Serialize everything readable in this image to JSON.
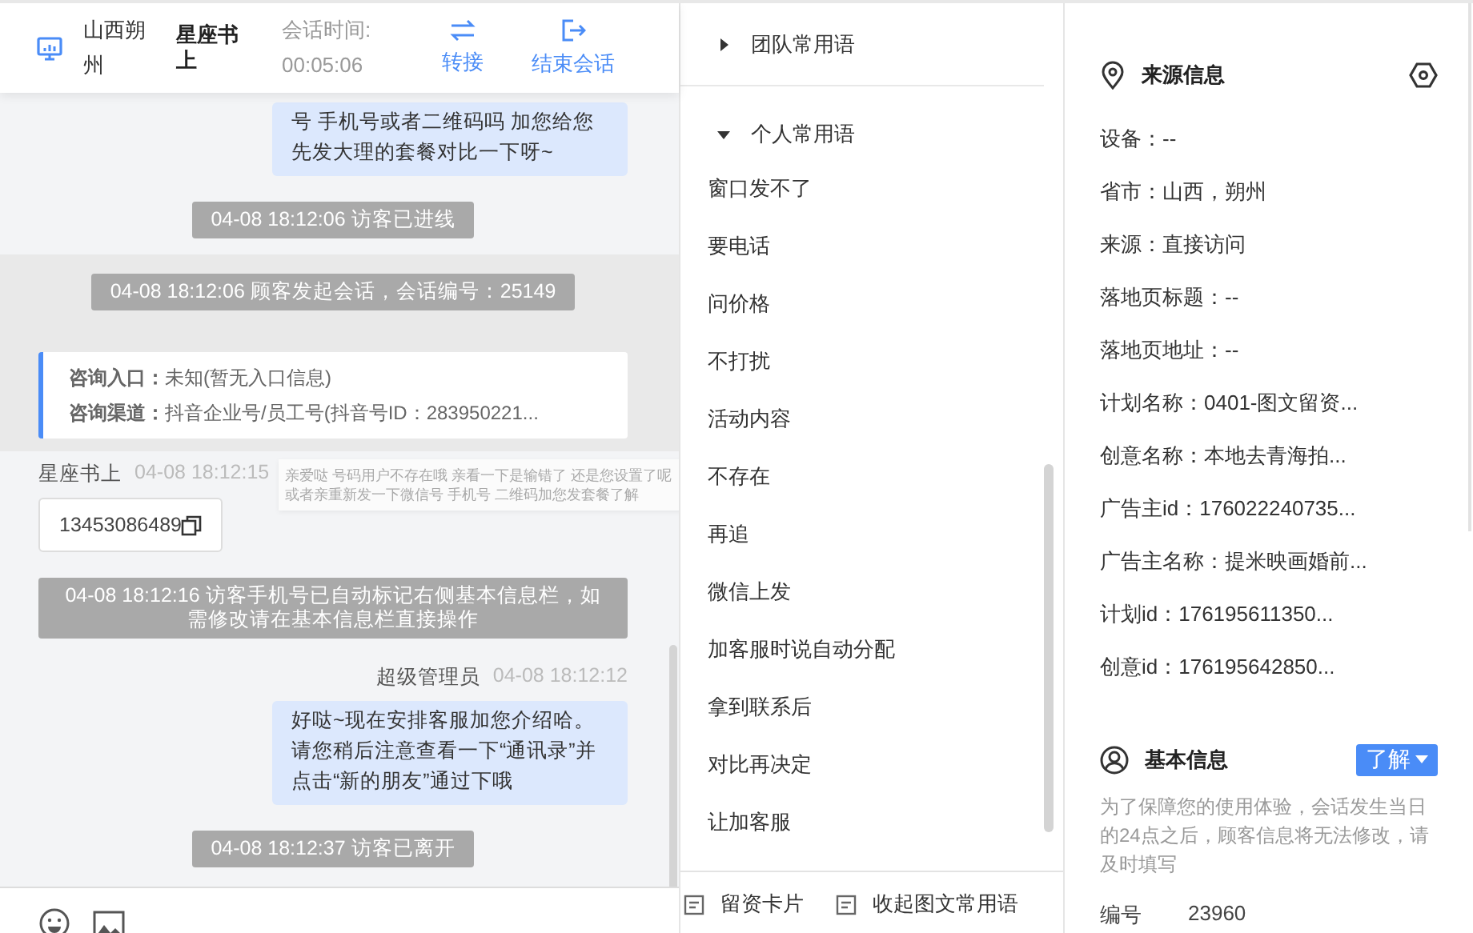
{
  "chat_header": {
    "location": "山西朔州",
    "visitor": "星座书上",
    "timer_label": "会话时间:",
    "timer": "00:05:06",
    "actions": [
      {
        "kind": "transfer",
        "label": "转接"
      },
      {
        "kind": "end",
        "label": "结束会话"
      }
    ]
  },
  "messages": [
    {
      "kind": "agent_bubble",
      "highlighted": false,
      "text": "号 手机号或者二维码吗 加您给您先发大理的套餐对比一下呀~"
    },
    {
      "kind": "system",
      "highlighted": false,
      "text": "04-08 18:12:06 访客已进线"
    },
    {
      "kind": "system",
      "highlighted": true,
      "text": "04-08 18:12:06 顾客发起会话，会话编号：25149"
    },
    {
      "kind": "info_card",
      "highlighted": true,
      "lines": [
        "**咨询入口：**未知(暂无入口信息)",
        "**咨询渠道：**抖音企业号/员工号(抖音号ID：283950221..."
      ]
    },
    {
      "kind": "visitor",
      "highlighted": false,
      "sender": "星座书上",
      "time": "04-08 18:12:15",
      "text": "13453086489"
    },
    {
      "kind": "system",
      "highlighted": false,
      "text": "04-08 18:12:16 访客手机号已自动标记右侧基本信息栏，如需修改请在基本信息栏直接操作"
    },
    {
      "kind": "agent",
      "highlighted": false,
      "sender": "超级管理员",
      "time": "04-08 18:12:12",
      "text": "好哒~现在安排客服加您介绍哈。请您稍后注意查看一下“通讯录”并点击“新的朋友”通过下哦"
    },
    {
      "kind": "system",
      "highlighted": false,
      "text": "04-08 18:12:37 访客已离开"
    }
  ],
  "hover_tip": "亲爱哒 号码用户不存在哦 亲看一下是输错了 还是您设置了呢或者亲重新发一下微信号 手机号 二维码加您发套餐了解",
  "phrases": {
    "groups": [
      {
        "label": "团队常用语",
        "expanded": false
      },
      {
        "label": "个人常用语",
        "expanded": true
      }
    ],
    "items": [
      "窗口发不了",
      "要电话",
      "问价格",
      "不打扰",
      "活动内容",
      "不存在",
      "再追",
      "微信上发",
      "加客服时说自动分配",
      "拿到联系后",
      "对比再决定",
      "让加客服"
    ],
    "footer": [
      "留资卡片",
      "收起图文常用语"
    ]
  },
  "source_info": {
    "title": "来源信息",
    "rows": [
      "设备：--",
      "省市：山西，朔州",
      "来源：直接访问",
      "落地页标题：--",
      "落地页地址：--",
      "计划名称：0401-图文留资...",
      "创意名称：本地去青海拍...",
      "广告主id：176022240735...",
      "广告主名称：提米映画婚前...",
      "计划id：176195611350...",
      "创意id：176195642850..."
    ]
  },
  "basic_info": {
    "title": "基本信息",
    "button": "了解",
    "note": "为了保障您的使用体验，会话发生当日的24点之后，顾客信息将无法修改，请及时填写",
    "fields": [
      {
        "label": "编号",
        "value": "23960"
      }
    ]
  }
}
